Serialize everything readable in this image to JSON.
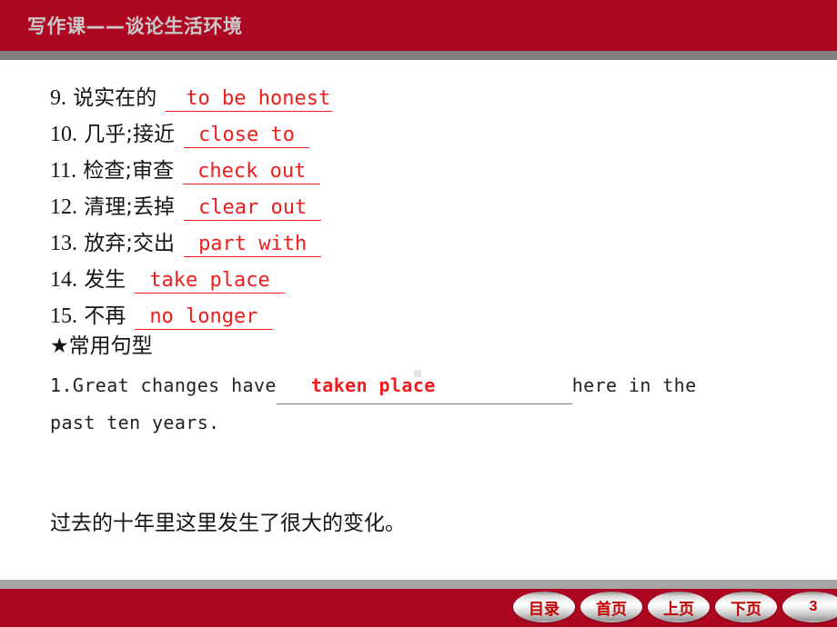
{
  "header": {
    "title": "写作课——谈论生活环境"
  },
  "content": {
    "vocab_items": [
      {
        "num": "9.",
        "cn": "说实在的",
        "answer": "to be honest"
      },
      {
        "num": "10.",
        "cn": "几乎;接近",
        "answer": "close to"
      },
      {
        "num": "11.",
        "cn": "检查;审查",
        "answer": "check out"
      },
      {
        "num": "12.",
        "cn": "清理;丢掉",
        "answer": "clear out"
      },
      {
        "num": "13.",
        "cn": "放弃;交出",
        "answer": "part with"
      },
      {
        "num": "14.",
        "cn": "发生",
        "answer": "take place"
      },
      {
        "num": "15.",
        "cn": "不再",
        "answer": "no longer"
      }
    ],
    "pattern_heading": "★常用句型",
    "sentence": {
      "number": "1.",
      "part1": "Great changes have",
      "blank_answer": "taken place",
      "part2": "here in the",
      "part3": "past ten years.",
      "translation": "过去的十年里这里发生了很大的变化。"
    }
  },
  "footer": {
    "nav_buttons": [
      {
        "label": "目录"
      },
      {
        "label": "首页"
      },
      {
        "label": "上页"
      },
      {
        "label": "下页"
      }
    ],
    "page_number": "3"
  }
}
